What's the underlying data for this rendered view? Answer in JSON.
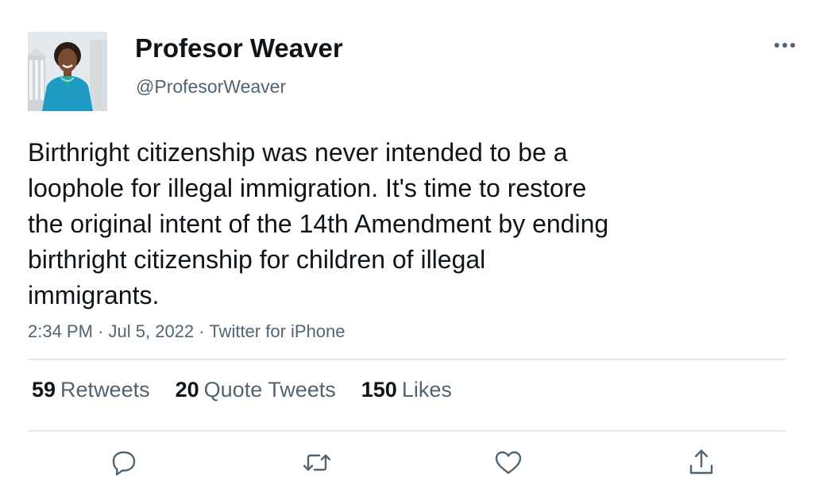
{
  "author": {
    "display_name": "Profesor Weaver",
    "handle": "@ProfesorWeaver"
  },
  "tweet": {
    "text": "Birthright citizenship was never intended to be a\nloophole for illegal immigration. It's time to restore\nthe original intent of the 14th Amendment by ending\nbirthright citizenship for children of illegal\nimmigrants.",
    "time": "2:34 PM",
    "separator": "·",
    "date": "Jul 5, 2022",
    "source": "Twitter for iPhone"
  },
  "stats": {
    "retweets_count": "59",
    "retweets_label": "Retweets",
    "quotes_count": "20",
    "quotes_label": "Quote Tweets",
    "likes_count": "150",
    "likes_label": "Likes"
  },
  "icons": {
    "more": "more-dots-icon",
    "reply": "reply-bubble-icon",
    "retweet": "retweet-arrows-icon",
    "like": "heart-icon",
    "share": "share-upload-icon"
  },
  "colors": {
    "primary_text": "#0f1419",
    "secondary_text": "#536471",
    "divider": "#e6e9eb"
  }
}
